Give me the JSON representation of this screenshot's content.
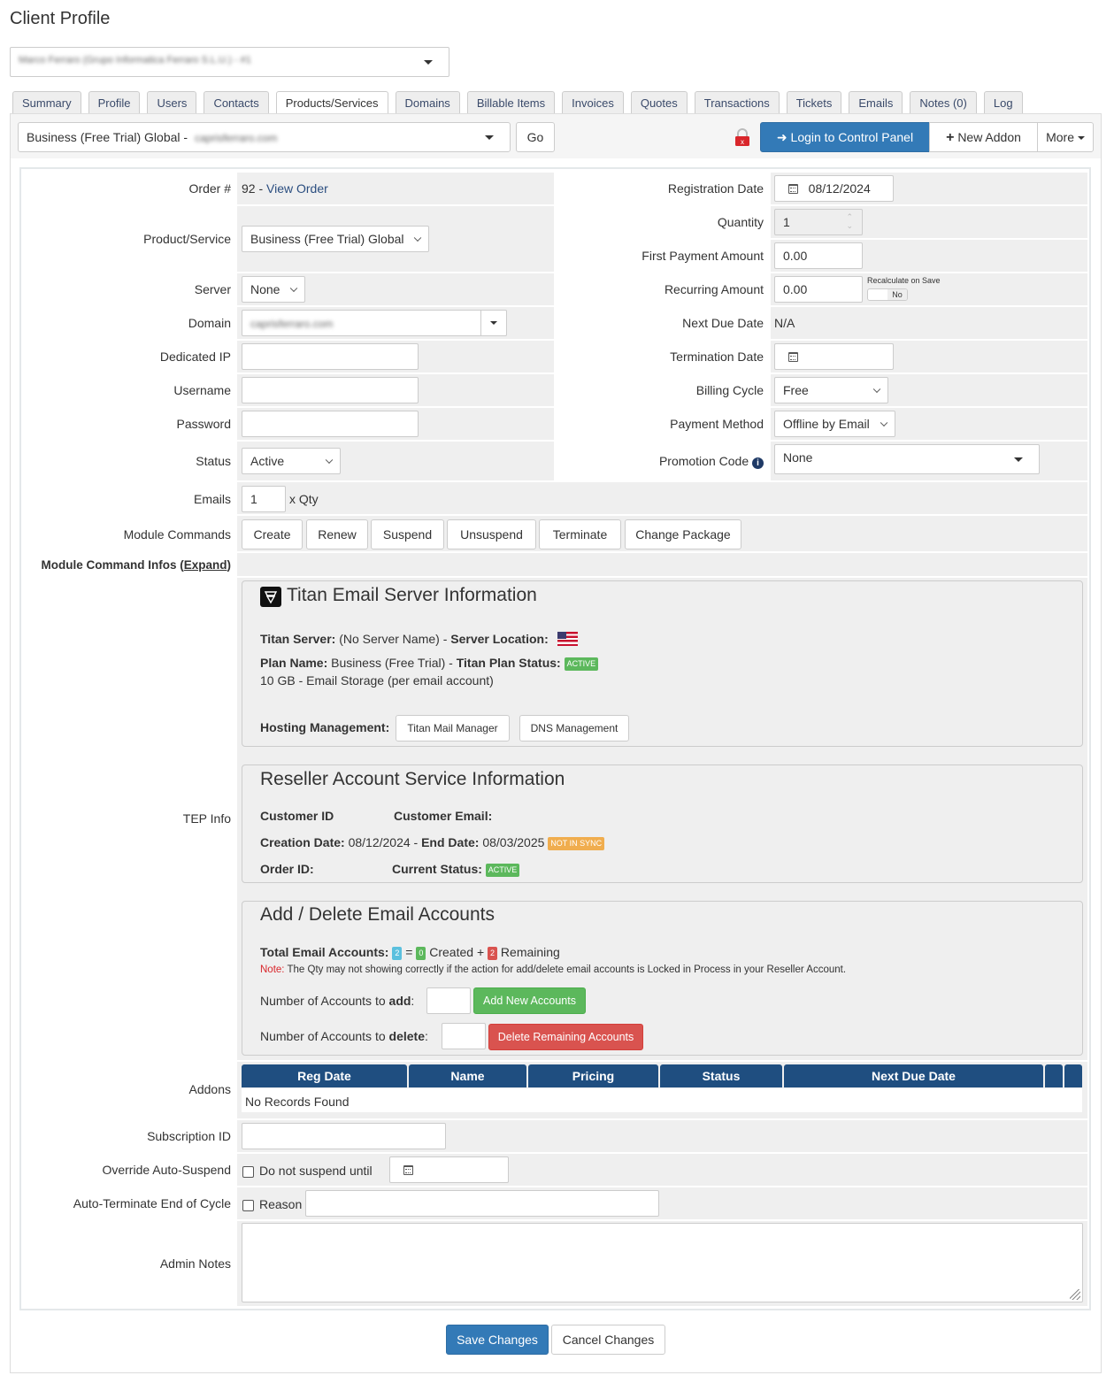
{
  "page": {
    "title": "Client Profile"
  },
  "client_select": {
    "value": "Marco Ferraro (Grupo Informatica Ferraro S.L.U.) - #1"
  },
  "tabs": [
    {
      "label": "Summary"
    },
    {
      "label": "Profile"
    },
    {
      "label": "Users"
    },
    {
      "label": "Contacts"
    },
    {
      "label": "Products/Services",
      "active": true
    },
    {
      "label": "Domains"
    },
    {
      "label": "Billable Items"
    },
    {
      "label": "Invoices"
    },
    {
      "label": "Quotes"
    },
    {
      "label": "Transactions"
    },
    {
      "label": "Tickets"
    },
    {
      "label": "Emails"
    },
    {
      "label": "Notes (0)"
    },
    {
      "label": "Log"
    }
  ],
  "toolbar": {
    "service_select": {
      "prefix": "Business (Free Trial) Global - ",
      "domain": "caprisferraro.com"
    },
    "go_label": "Go",
    "login_label": "Login to Control Panel",
    "new_addon_label": "New Addon",
    "more_label": "More"
  },
  "form": {
    "order": {
      "label": "Order #",
      "number": "92 - ",
      "link": "View Order"
    },
    "product": {
      "label": "Product/Service",
      "value": "Business (Free Trial) Global"
    },
    "server": {
      "label": "Server",
      "value": "None"
    },
    "domain": {
      "label": "Domain",
      "value": "caprisferraro.com"
    },
    "dedicated_ip": {
      "label": "Dedicated IP",
      "value": ""
    },
    "username": {
      "label": "Username",
      "value": ""
    },
    "password": {
      "label": "Password",
      "value": ""
    },
    "status": {
      "label": "Status",
      "value": "Active"
    },
    "registration_date": {
      "label": "Registration Date",
      "value": "08/12/2024"
    },
    "quantity": {
      "label": "Quantity",
      "value": "1"
    },
    "first_payment": {
      "label": "First Payment Amount",
      "value": "0.00"
    },
    "recurring": {
      "label": "Recurring Amount",
      "value": "0.00",
      "recalc_label": "Recalculate on Save",
      "toggle": "No"
    },
    "next_due": {
      "label": "Next Due Date",
      "value": "N/A"
    },
    "termination_date": {
      "label": "Termination Date",
      "value": ""
    },
    "billing_cycle": {
      "label": "Billing Cycle",
      "value": "Free"
    },
    "payment_method": {
      "label": "Payment Method",
      "value": "Offline by Email"
    },
    "promo": {
      "label": "Promotion Code",
      "value": "None"
    },
    "emails": {
      "label": "Emails",
      "value": "1",
      "suffix": "x Qty"
    },
    "module_commands": {
      "label": "Module Commands",
      "buttons": [
        "Create",
        "Renew",
        "Suspend",
        "Unsuspend",
        "Terminate",
        "Change Package"
      ]
    },
    "module_infos": {
      "label": "Module Command Infos (",
      "link": "Expand",
      "end": ")"
    },
    "tep_label": "TEP Info",
    "addons_label": "Addons",
    "subscription": {
      "label": "Subscription ID",
      "value": ""
    },
    "override": {
      "label": "Override Auto-Suspend",
      "check_label": "Do not suspend until"
    },
    "auto_term": {
      "label": "Auto-Terminate End of Cycle",
      "check_label": "Reason"
    },
    "admin_notes": {
      "label": "Admin Notes",
      "value": ""
    }
  },
  "titan": {
    "title": "Titan Email Server Information",
    "server_label": "Titan Server:",
    "server_value": " (No Server Name) - ",
    "location_label": "Server Location:",
    "location_flag": "us-flag",
    "plan_label": "Plan Name:",
    "plan_value": " Business (Free Trial) - ",
    "plan_status_label": "Titan Plan Status:",
    "plan_status": "ACTIVE",
    "storage": "10 GB - Email Storage (per email account)",
    "hosting_label": "Hosting Management:",
    "btn_mail": "Titan Mail Manager",
    "btn_dns": "DNS Management"
  },
  "reseller": {
    "title": "Reseller Account Service Information",
    "customer_id_label": "Customer ID",
    "customer_email_label": "Customer Email:",
    "creation_label": "Creation Date:",
    "creation_value": " 08/12/2024 - ",
    "end_label": "End Date:",
    "end_value": " 08/03/2025",
    "sync_badge": "NOT IN SYNC",
    "order_id_label": "Order ID:",
    "current_status_label": "Current Status:",
    "current_status": "ACTIVE"
  },
  "accounts": {
    "title": "Add / Delete Email Accounts",
    "total_label": "Total Email Accounts:",
    "total": "2",
    "eq": " = ",
    "created": "0",
    "created_label": " Created + ",
    "remaining": "2",
    "remaining_label": " Remaining",
    "note_label": "Note:",
    "note": " The Qty may not showing correctly if the action for add/delete email accounts is Locked in Process in your Reseller Account.",
    "add_label_a": "Number of Accounts to ",
    "add_label_b": "add",
    "add_colon": ":",
    "add_button": "Add New Accounts",
    "del_label_a": "Number of Accounts to ",
    "del_label_b": "delete",
    "del_colon": ":",
    "del_button": "Delete Remaining Accounts"
  },
  "addons_table": {
    "columns": [
      "Reg Date",
      "Name",
      "Pricing",
      "Status",
      "Next Due Date",
      "",
      ""
    ],
    "empty": "No Records Found"
  },
  "footer": {
    "save_label": "Save Changes",
    "cancel_label": "Cancel Changes"
  },
  "colors": {
    "primary": "#337ab7",
    "success": "#5cb85c",
    "danger": "#d9534f",
    "warning": "#f0ad4e",
    "info": "#5bc0de",
    "table_header": "#1f4e80"
  }
}
